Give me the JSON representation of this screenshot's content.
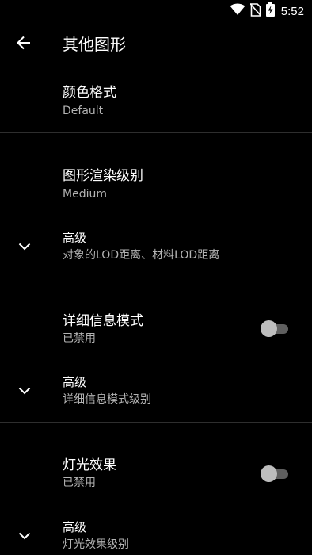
{
  "status_bar": {
    "time": "5:52",
    "icons": [
      "wifi-icon",
      "no-sim-icon",
      "battery-charging-icon"
    ]
  },
  "toolbar": {
    "back_icon": "arrow-back-icon",
    "title": "其他图形"
  },
  "prefs": {
    "color_format": {
      "title": "颜色格式",
      "summary": "Default"
    },
    "graphics_render_level": {
      "title": "图形渲染级别",
      "summary": "Medium"
    },
    "advanced_lod": {
      "title": "高级",
      "summary": "对象的LOD距离、材料LOD距离",
      "icon": "chevron-down-icon"
    },
    "detail_info_mode": {
      "title": "详细信息模式",
      "summary": "已禁用",
      "enabled": false
    },
    "advanced_detail": {
      "title": "高级",
      "summary": "详细信息模式级别",
      "icon": "chevron-down-icon"
    },
    "lighting_effects": {
      "title": "灯光效果",
      "summary": "已禁用",
      "enabled": false
    },
    "advanced_lighting": {
      "title": "高级",
      "summary": "灯光效果级别",
      "icon": "chevron-down-icon"
    }
  },
  "colors": {
    "background": "#000000",
    "primary_text": "#ffffff",
    "secondary_text": "#b3b3b3",
    "divider": "#2e2e2e",
    "switch_track_off": "#5f5f5f",
    "switch_thumb_off": "#bdbdbd"
  }
}
